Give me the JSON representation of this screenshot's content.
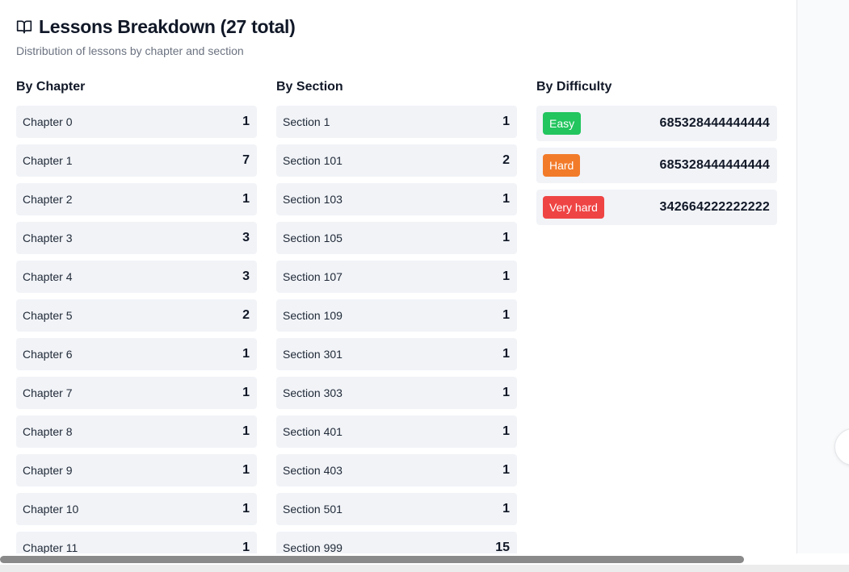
{
  "header": {
    "title": "Lessons Breakdown (27 total)",
    "subtitle": "Distribution of lessons by chapter and section",
    "icon": "book-open-icon"
  },
  "by_chapter": {
    "title": "By Chapter",
    "rows": [
      {
        "label": "Chapter 0",
        "count": "1"
      },
      {
        "label": "Chapter 1",
        "count": "7"
      },
      {
        "label": "Chapter 2",
        "count": "1"
      },
      {
        "label": "Chapter 3",
        "count": "3"
      },
      {
        "label": "Chapter 4",
        "count": "3"
      },
      {
        "label": "Chapter 5",
        "count": "2"
      },
      {
        "label": "Chapter 6",
        "count": "1"
      },
      {
        "label": "Chapter 7",
        "count": "1"
      },
      {
        "label": "Chapter 8",
        "count": "1"
      },
      {
        "label": "Chapter 9",
        "count": "1"
      },
      {
        "label": "Chapter 10",
        "count": "1"
      },
      {
        "label": "Chapter 11",
        "count": "1"
      }
    ]
  },
  "by_section": {
    "title": "By Section",
    "rows": [
      {
        "label": "Section 1",
        "count": "1"
      },
      {
        "label": "Section 101",
        "count": "2"
      },
      {
        "label": "Section 103",
        "count": "1"
      },
      {
        "label": "Section 105",
        "count": "1"
      },
      {
        "label": "Section 107",
        "count": "1"
      },
      {
        "label": "Section 109",
        "count": "1"
      },
      {
        "label": "Section 301",
        "count": "1"
      },
      {
        "label": "Section 303",
        "count": "1"
      },
      {
        "label": "Section 401",
        "count": "1"
      },
      {
        "label": "Section 403",
        "count": "1"
      },
      {
        "label": "Section 501",
        "count": "1"
      },
      {
        "label": "Section 999",
        "count": "15"
      }
    ]
  },
  "by_difficulty": {
    "title": "By Difficulty",
    "rows": [
      {
        "label": "Easy",
        "value": "685328444444444",
        "color": "#22c55e"
      },
      {
        "label": "Hard",
        "value": "685328444444444",
        "color": "#f27b2a"
      },
      {
        "label": "Very hard",
        "value": "342664222222222",
        "color": "#ef4444"
      }
    ]
  },
  "colors": {
    "row_background": "#f1f3f7",
    "subtitle": "#6b7280",
    "scroll_thumb": "#8a8a8a"
  }
}
